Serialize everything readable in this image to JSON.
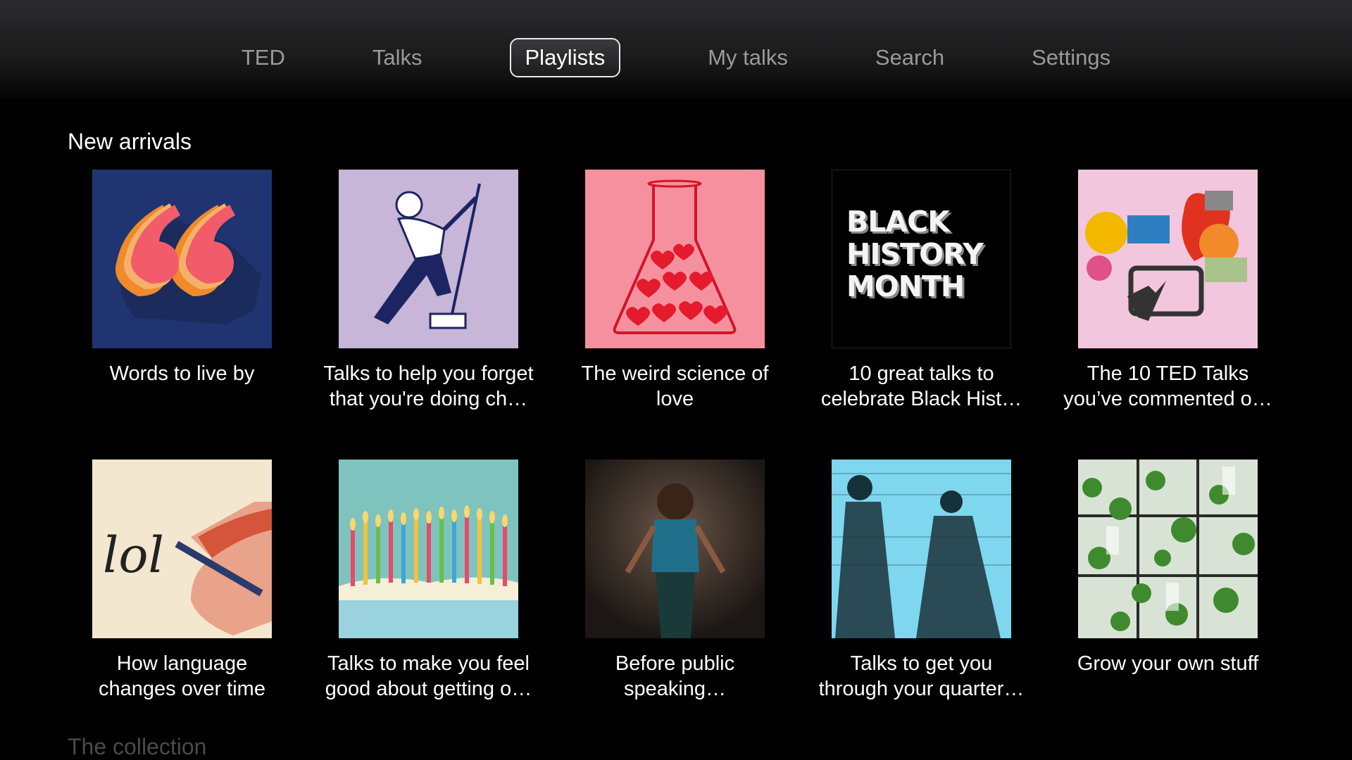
{
  "nav": {
    "tabs": [
      {
        "label": "TED"
      },
      {
        "label": "Talks"
      },
      {
        "label": "Playlists"
      },
      {
        "label": "My talks"
      },
      {
        "label": "Search"
      },
      {
        "label": "Settings"
      }
    ],
    "active_tab": "Playlists"
  },
  "sections": [
    {
      "title": "New arrivals",
      "rows": [
        [
          {
            "title_line1": "Words to live by",
            "title_line2": "",
            "art": "quote-marks-icon"
          },
          {
            "title_line1": "Talks to help you forget",
            "title_line2": "that you're doing ch…",
            "art": "mopping-man-illustration"
          },
          {
            "title_line1": "The weird science of",
            "title_line2": "love",
            "art": "flask-hearts-icon"
          },
          {
            "title_line1": "10 great talks to",
            "title_line2": "celebrate Black Hist…",
            "art": "black-history-month-art",
            "art_text": [
              "BLACK",
              "HISTORY",
              "MONTH"
            ]
          },
          {
            "title_line1": "The 10 TED Talks",
            "title_line2": "you’ve commented o…",
            "art": "speech-bubbles-tablet-icon"
          }
        ],
        [
          {
            "title_line1": "How language",
            "title_line2": "changes over time",
            "art": "lol-pen-illustration"
          },
          {
            "title_line1": "Talks to make you feel",
            "title_line2": "good about getting o…",
            "art": "birthday-candles-photo"
          },
          {
            "title_line1": "Before public",
            "title_line2": "speaking…",
            "art": "speaker-on-stage-photo"
          },
          {
            "title_line1": "Talks to get you",
            "title_line2": "through your quarter…",
            "art": "victorian-women-engraving"
          },
          {
            "title_line1": "Grow your own stuff",
            "title_line2": "",
            "art": "window-garden-photo"
          }
        ]
      ]
    },
    {
      "title": "The collection"
    }
  ],
  "colors": {
    "background": "#000000",
    "tab_inactive": "#9a9a9a",
    "tab_active": "#ffffff"
  }
}
